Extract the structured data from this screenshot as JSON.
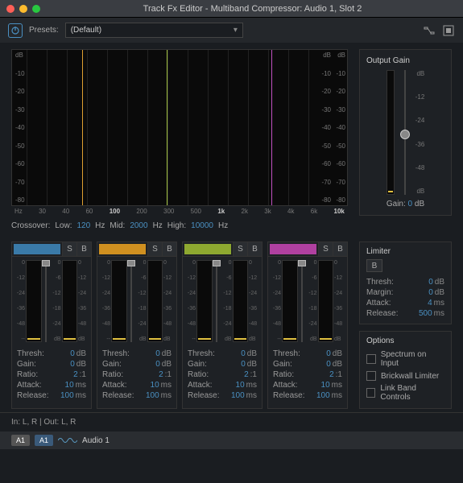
{
  "window": {
    "title": "Track Fx Editor - Multiband Compressor: Audio 1, Slot 2"
  },
  "toolbar": {
    "presets_label": "Presets:",
    "preset_value": "(Default)"
  },
  "graph": {
    "scale_db": [
      "dB",
      "-10",
      "-20",
      "-30",
      "-40",
      "-50",
      "-60",
      "-70",
      "-80"
    ],
    "xaxis": [
      "Hz",
      "30",
      "40",
      "60",
      "100",
      "200",
      "300",
      "500",
      "1k",
      "2k",
      "3k",
      "4k",
      "6k",
      "10k"
    ],
    "xaxis_hl": [
      "100",
      "1k",
      "10k"
    ]
  },
  "crossover": {
    "label": "Crossover:",
    "low_label": "Low:",
    "low_val": "120",
    "mid_label": "Mid:",
    "mid_val": "2000",
    "high_label": "High:",
    "high_val": "10000",
    "hz": "Hz"
  },
  "output_gain": {
    "title": "Output Gain",
    "scale": [
      "dB",
      "-12",
      "-24",
      "-36",
      "-48",
      "dB"
    ],
    "gain_label": "Gain:",
    "gain_val": "0",
    "gain_unit": "dB"
  },
  "band_btns": {
    "s": "S",
    "b": "B"
  },
  "band_scale_left": [
    "0",
    "-12",
    "-24",
    "-36",
    "-48",
    "--"
  ],
  "band_scale_mid": [
    "0",
    "-6",
    "-12",
    "-18",
    "-24",
    "dB"
  ],
  "band_scale_right": [
    "0",
    "-12",
    "-24",
    "-36",
    "-48",
    "dB"
  ],
  "band_params": {
    "thresh": "Thresh:",
    "gain": "Gain:",
    "ratio": "Ratio:",
    "attack": "Attack:",
    "release": "Release:"
  },
  "bands": [
    {
      "thresh": "0",
      "gain": "0",
      "ratio": "2",
      "attack": "10",
      "release": "100"
    },
    {
      "thresh": "0",
      "gain": "0",
      "ratio": "2",
      "attack": "10",
      "release": "100"
    },
    {
      "thresh": "0",
      "gain": "0",
      "ratio": "2",
      "attack": "10",
      "release": "100"
    },
    {
      "thresh": "0",
      "gain": "0",
      "ratio": "2",
      "attack": "10",
      "release": "100"
    }
  ],
  "units": {
    "db": "dB",
    "ratio": ":1",
    "ms": "ms"
  },
  "limiter": {
    "title": "Limiter",
    "b": "B",
    "thresh_label": "Thresh:",
    "thresh_val": "0",
    "margin_label": "Margin:",
    "margin_val": "0",
    "attack_label": "Attack:",
    "attack_val": "4",
    "release_label": "Release:",
    "release_val": "500"
  },
  "options": {
    "title": "Options",
    "opt1": "Spectrum on Input",
    "opt2": "Brickwall Limiter",
    "opt3": "Link Band Controls"
  },
  "footer": {
    "io": "In: L, R | Out: L, R"
  },
  "bottombar": {
    "a1": "A1",
    "audio": "Audio 1"
  }
}
